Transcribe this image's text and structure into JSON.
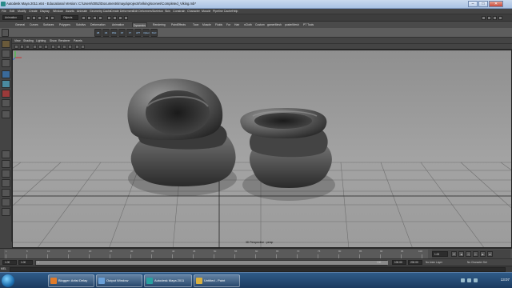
{
  "window": {
    "title": "Autodesk Maya 2011 x64 - Educational Version: C:\\Users\\0052\\Documents\\maya\\projects\\Viking\\scenes\\Completed_Viking.mb*",
    "minimize": "–",
    "maximize": "□",
    "close": "✕"
  },
  "menubar": [
    "File",
    "Edit",
    "Modify",
    "Create",
    "Display",
    "Window",
    "Assets",
    "Animate",
    "Geometry Cache",
    "Create Deformers",
    "Edit Deformers",
    "Skeleton",
    "Skin",
    "Constrain",
    "Character",
    "Muscle",
    "Pipeline Cache",
    "Help"
  ],
  "statusline": {
    "menuset": "Animation",
    "select_mode": "Objects"
  },
  "shelf": {
    "tabs": [
      "General",
      "Curves",
      "Surfaces",
      "Polygons",
      "Subdivs",
      "Deformation",
      "Animation",
      "Dynamics",
      "Rendering",
      "PaintEffects",
      "Toon",
      "Muscle",
      "Fluids",
      "Fur",
      "Hair",
      "nCloth",
      "Custom",
      "gamerMesh",
      "posterMesh",
      "PT Tools"
    ],
    "active_tab": "Dynamics",
    "icons": [
      "HB",
      "HS",
      "MAE",
      "CP",
      "FT",
      "HPT",
      "Upfeet",
      "Shell"
    ]
  },
  "panel_menu": [
    "View",
    "Shading",
    "Lighting",
    "Show",
    "Renderer",
    "Panels"
  ],
  "viewport": {
    "camera_label": "3D Perspective : persp"
  },
  "timeslider": {
    "ticks": [
      "1",
      "5",
      "10",
      "15",
      "20",
      "25",
      "30",
      "35",
      "40",
      "45",
      "50",
      "55",
      "60",
      "65",
      "70",
      "75",
      "80",
      "85",
      "90",
      "95",
      "100"
    ],
    "current_frame": "1.00"
  },
  "rangeslider": {
    "start_time": "1.00",
    "playback_start": "1.00",
    "range_label": "1",
    "range_end_label": "100",
    "playback_end": "100.00",
    "end_time": "200.00",
    "anim_layer": "No Anim Layer",
    "character_set": "No Character Set"
  },
  "cmdline": {
    "label": "MEL"
  },
  "taskbar": {
    "items": [
      {
        "label": "Blogger: Artist Delay",
        "color": "#e07b2a"
      },
      {
        "label": "Output Window",
        "color": "#6aa0d8"
      },
      {
        "label": "Autodesk Maya 2011",
        "color": "#2aa0a0"
      },
      {
        "label": "Untitled - Paint",
        "color": "#d8b040"
      }
    ],
    "clock": "13:07"
  }
}
